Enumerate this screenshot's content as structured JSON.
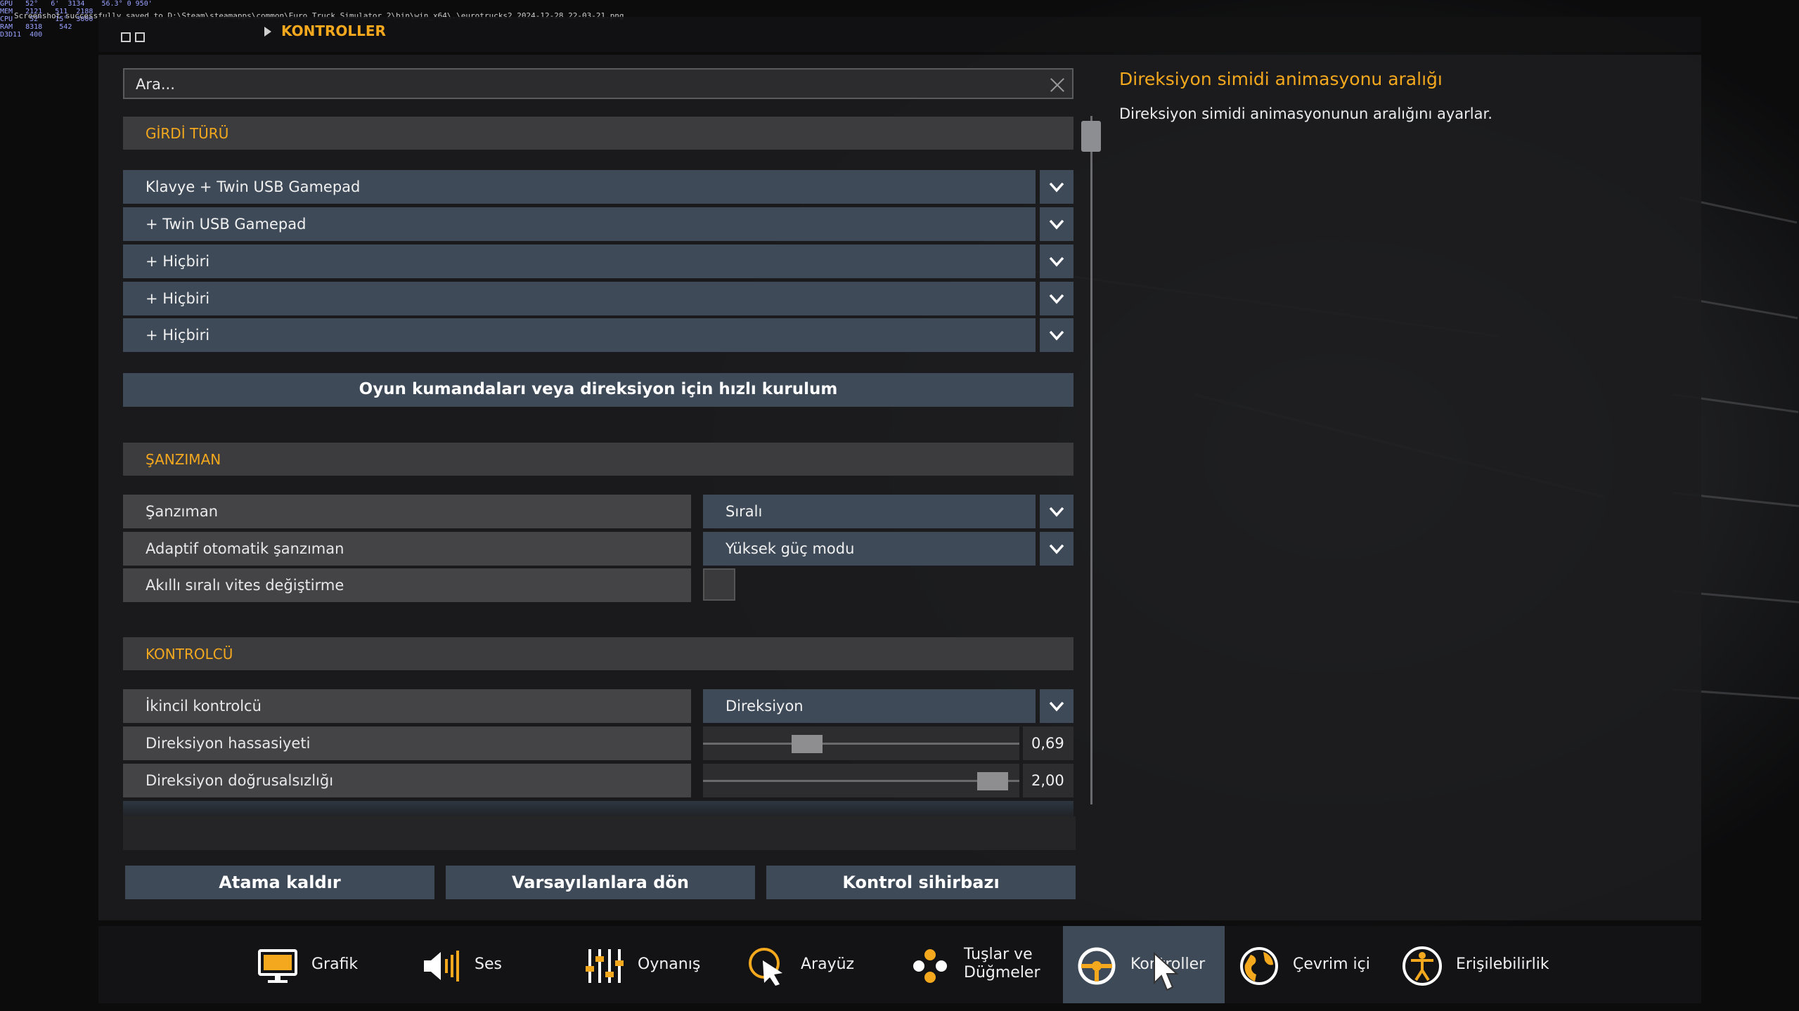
{
  "hud": {
    "overlay": "GPU   52°   6'  3134    56.3° 0 950'\nMEM   2121   511  2188\nCPU    52°   15°  3000\nRAM   8318    542\nD3D11  400",
    "path": "Screenshot successfully saved to D:\\Steam\\steamapps\\common\\Euro Truck Simulator 2\\bin\\win_x64\\.\\eurotrucks2 2024-12-28 22-03-21.png"
  },
  "breadcrumb": "KONTROLLER",
  "search": {
    "placeholder": "Ara..."
  },
  "sections": {
    "input_type": "GİRDİ TÜRÜ",
    "transmission": "ŞANZIMAN",
    "controller": "KONTROLCÜ"
  },
  "input_devices": [
    "Klavye + Twin USB Gamepad",
    "+ Twin USB Gamepad",
    "+ Hiçbiri",
    "+ Hiçbiri",
    "+ Hiçbiri"
  ],
  "quick_setup": "Oyun kumandaları veya direksiyon için hızlı kurulum",
  "transmission_rows": [
    {
      "label": "Şanzıman",
      "value": "Sıralı"
    },
    {
      "label": "Adaptif otomatik şanzıman",
      "value": "Yüksek güç modu"
    },
    {
      "label": "Akıllı sıralı vites değiştirme",
      "checked": false
    }
  ],
  "controller_rows": {
    "secondary": {
      "label": "İkincil kontrolcü",
      "value": "Direksiyon"
    },
    "sensitivity": {
      "label": "Direksiyon hassasiyeti",
      "value": "0,69",
      "fraction": 0.69
    },
    "nonlinearity": {
      "label": "Direksiyon doğrusalsızlığı",
      "value": "2,00",
      "fraction": 1.0
    }
  },
  "buttons": {
    "unbind": "Atama kaldır",
    "defaults": "Varsayılanlara dön",
    "wizard": "Kontrol sihirbazı"
  },
  "help": {
    "title": "Direksiyon simidi animasyonu aralığı",
    "description": "Direksiyon simidi animasyonunun aralığını ayarlar."
  },
  "nav": [
    {
      "label": "Grafik",
      "icon": "monitor-icon"
    },
    {
      "label": "Ses",
      "icon": "speaker-icon"
    },
    {
      "label": "Oynanış",
      "icon": "sliders-icon"
    },
    {
      "label": "Arayüz",
      "icon": "pointer-icon"
    },
    {
      "label": "Tuşlar ve",
      "label2": "Düğmeler",
      "icon": "buttons-icon"
    },
    {
      "label": "Kontroller",
      "icon": "steering-wheel-icon",
      "active": true
    },
    {
      "label": "Çevrim içi",
      "icon": "globe-icon"
    },
    {
      "label": "Erişilebilirlik",
      "icon": "accessibility-icon"
    }
  ],
  "colors": {
    "accent": "#f3a81e",
    "row": "#3e4a57",
    "label": "#444446"
  }
}
